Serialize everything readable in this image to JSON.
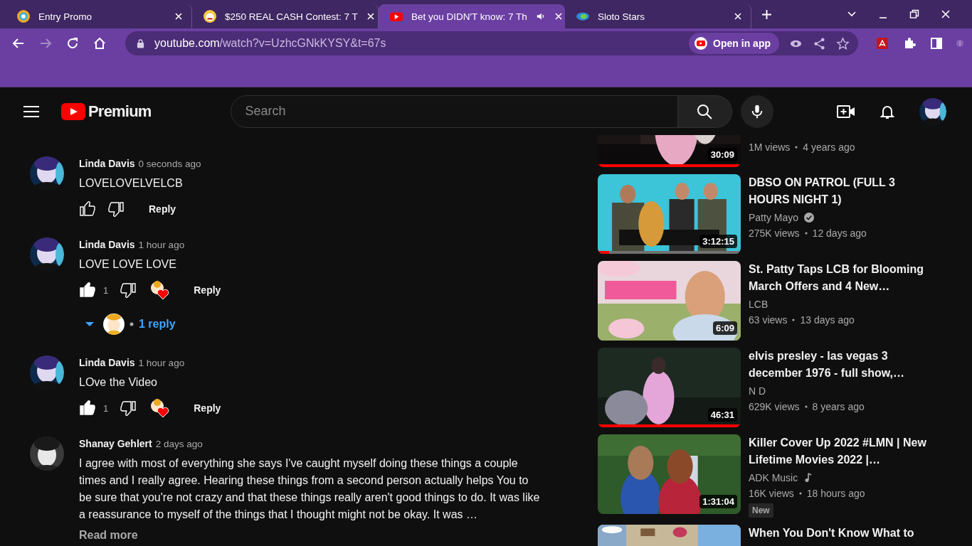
{
  "browser": {
    "tabs": [
      {
        "title": "Entry Promo",
        "selected": false,
        "audio": false
      },
      {
        "title": "$250 REAL CASH Contest: 7 T",
        "selected": false,
        "audio": false
      },
      {
        "title": "Bet you DIDN'T know: 7 Th",
        "selected": true,
        "audio": true
      },
      {
        "title": "Sloto Stars",
        "selected": false,
        "audio": false
      }
    ],
    "address": {
      "host": "youtube.com",
      "path": "/watch?v=UzhcGNkKYSY&t=67s"
    },
    "open_in_app": "Open in app"
  },
  "youtube": {
    "logo": "Premium",
    "search": {
      "placeholder": "Search"
    }
  },
  "comments": [
    {
      "author": "Linda Davis",
      "time": "0 seconds ago",
      "text": "LOVELOVELVELCB",
      "liked": false,
      "hearted": false,
      "reply_button": "Reply"
    },
    {
      "author": "Linda Davis",
      "time": "1 hour ago",
      "text": "LOVE LOVE LOVE",
      "liked": true,
      "likes": "1",
      "hearted": true,
      "reply_button": "Reply",
      "replies": "1 reply"
    },
    {
      "author": "Linda Davis",
      "time": "1 hour ago",
      "text": "LOve the Video",
      "liked": true,
      "likes": "1",
      "hearted": true,
      "reply_button": "Reply"
    },
    {
      "author": "Shanay Gehlert",
      "time": "2 days ago",
      "text": "I agree with most of everything she says I've caught myself doing these things a couple times and I really agree. Hearing these things from a second person actually helps You to be sure that you're not crazy and that these things really aren't good things to do. It was like a reassurance to myself of the things that I thought might not be okay. It was …",
      "read_more": "Read more"
    }
  ],
  "videos": [
    {
      "clipped": true,
      "duration": "30:09",
      "level": 1,
      "views": "1M views",
      "age": "4 years ago"
    },
    {
      "title": "DBSO ON PATROL (FULL 3 HOURS NIGHT 1)",
      "channel": "Patty Mayo",
      "duration": "3:12:15",
      "level": 0.08,
      "views": "275K views",
      "age": "12 days ago"
    },
    {
      "title": "St. Patty Taps LCB for Blooming March Offers and 4 New…",
      "channel": "LCB",
      "duration": "6:09",
      "views": "63 views",
      "age": "13 days ago"
    },
    {
      "title": "elvis presley - las vegas 3 december 1976 - full show,…",
      "channel": "N D",
      "duration": "46:31",
      "level": 1,
      "views": "629K views",
      "age": "8 years ago"
    },
    {
      "title": "Killer Cover Up 2022 #LMN | New Lifetime Movies 2022 |…",
      "channel": "ADK Music",
      "duration": "1:31:04",
      "views": "16K views",
      "age": "18 hours ago",
      "new_label": "New"
    },
    {
      "title": "When You Don't Know What to",
      "clipped_bottom": true
    }
  ]
}
